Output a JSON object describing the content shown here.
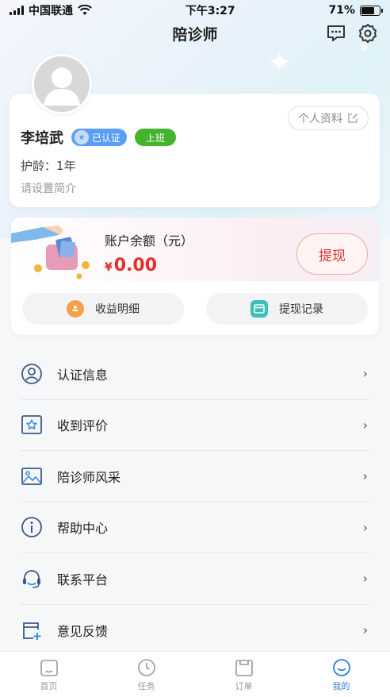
{
  "status_bar": {
    "carrier": "中国联通",
    "time": "下午3:27",
    "battery_pct": "71%",
    "battery_level": 0.71
  },
  "nav": {
    "title": "陪诊师",
    "icons": [
      "message-icon",
      "settings-icon"
    ]
  },
  "profile": {
    "profile_button": "个人资料",
    "name": "李培武",
    "verified_label": "已认证",
    "status_label": "上班",
    "experience": "护龄：1年",
    "intro_placeholder": "请设置简介"
  },
  "balance": {
    "label": "账户余额（元）",
    "currency": "¥",
    "amount": "0.00",
    "withdraw_label": "提现",
    "income_details_label": "收益明细",
    "withdraw_records_label": "提现记录"
  },
  "menu": {
    "items": [
      {
        "label": "认证信息",
        "icon": "id-verify-icon"
      },
      {
        "label": "收到评价",
        "icon": "star-review-icon"
      },
      {
        "label": "陪诊师风采",
        "icon": "gallery-icon"
      },
      {
        "label": "帮助中心",
        "icon": "info-icon"
      },
      {
        "label": "联系平台",
        "icon": "headset-icon"
      },
      {
        "label": "意见反馈",
        "icon": "feedback-icon"
      }
    ]
  },
  "tabbar": {
    "tabs": [
      {
        "label": "首页",
        "icon": "home-icon",
        "active": false
      },
      {
        "label": "任务",
        "icon": "clock-icon",
        "active": false
      },
      {
        "label": "订单",
        "icon": "order-icon",
        "active": false
      },
      {
        "label": "我的",
        "icon": "profile-icon",
        "active": true
      }
    ]
  },
  "colors": {
    "accent_blue": "#2f7de1",
    "verified_blue": "#5a9ef7",
    "duty_green": "#46b32f",
    "amount_red": "#e0312b"
  }
}
